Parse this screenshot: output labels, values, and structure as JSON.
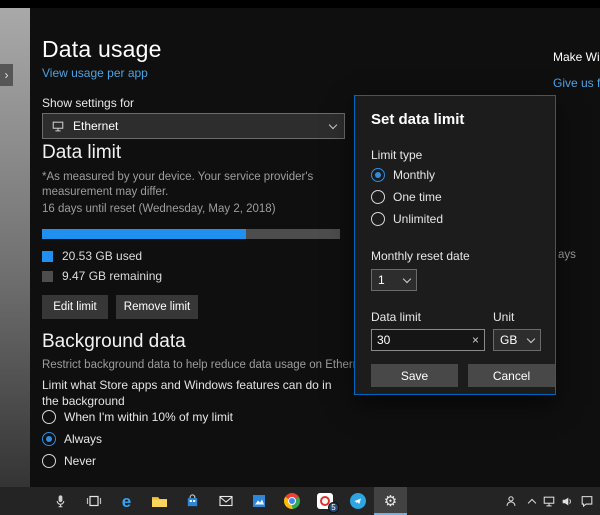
{
  "page": {
    "title": "Data usage",
    "view_usage_link": "View usage per app",
    "clipped_right_top": "Make Wind",
    "clipped_right_link": "Give us feed",
    "clipped_fragment": "ays"
  },
  "show_settings": {
    "label": "Show settings for",
    "selected": "Ethernet"
  },
  "data_limit": {
    "heading": "Data limit",
    "note": "*As measured by your device. Your service provider's measurement may differ.",
    "reset_info": "16 days until reset (Wednesday, May 2, 2018)",
    "used_percent": 68.4,
    "used_label": "20.53 GB used",
    "remaining_label": "9.47 GB remaining",
    "edit_button": "Edit limit",
    "remove_button": "Remove limit"
  },
  "background_data": {
    "heading": "Background data",
    "description": "Restrict background data to help reduce data usage on Ethernet.",
    "question": "Limit what Store apps and Windows features can do in the background",
    "options": [
      {
        "label": "When I'm within 10% of my limit",
        "selected": false
      },
      {
        "label": "Always",
        "selected": true
      },
      {
        "label": "Never",
        "selected": false
      }
    ]
  },
  "dialog": {
    "title": "Set data limit",
    "limit_type_label": "Limit type",
    "limit_types": [
      {
        "label": "Monthly",
        "selected": true
      },
      {
        "label": "One time",
        "selected": false
      },
      {
        "label": "Unlimited",
        "selected": false
      }
    ],
    "reset_date_label": "Monthly reset date",
    "reset_date_value": "1",
    "data_limit_label": "Data limit",
    "unit_label": "Unit",
    "data_limit_value": "30",
    "clear_glyph": "×",
    "unit_value": "GB",
    "save_button": "Save",
    "cancel_button": "Cancel"
  },
  "taskbar": {
    "badge": "5",
    "pinned_icons": [
      "mic",
      "task-view",
      "edge",
      "file-explorer",
      "store",
      "mail",
      "photos",
      "chrome",
      "opera",
      "telegram",
      "settings"
    ],
    "tray_icons": [
      "people",
      "chevron-up",
      "network",
      "volume",
      "action-center"
    ]
  },
  "icons": {
    "left_edge_arrow": "›",
    "gear": "⚙",
    "edge_letter": "e"
  },
  "colors": {
    "accent": "#0078d7",
    "link": "#4ca2e0",
    "bar_fill": "#2090f0",
    "bar_track": "#4d4d4d",
    "used_swatch": "#2090f0",
    "remaining_swatch": "#4d4d4d",
    "dialog_border": "#0067c0"
  }
}
